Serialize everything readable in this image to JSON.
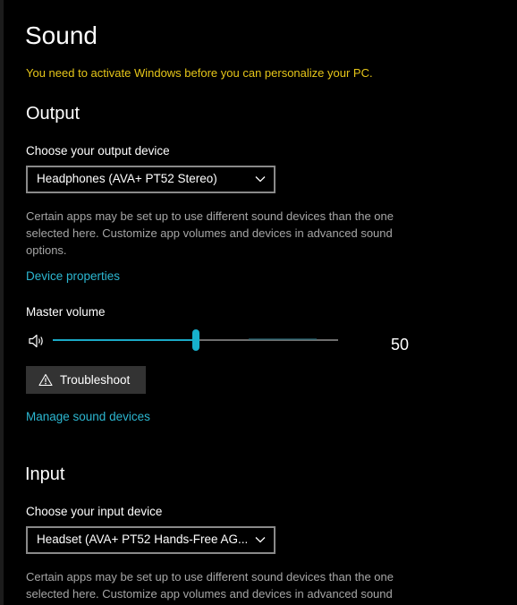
{
  "page": {
    "title": "Sound",
    "activation_notice": "You need to activate Windows before you can personalize your PC."
  },
  "output": {
    "heading": "Output",
    "device_label": "Choose your output device",
    "device_value": "Headphones (AVA+ PT52 Stereo)",
    "description": "Certain apps may be set up to use different sound devices than the one selected here. Customize app volumes and devices in advanced sound options.",
    "device_properties_link": "Device properties",
    "master_volume_label": "Master volume",
    "volume_value": "50",
    "volume_level": 50,
    "troubleshoot_label": "Troubleshoot",
    "manage_link": "Manage sound devices"
  },
  "input": {
    "heading": "Input",
    "device_label": "Choose your input device",
    "device_value": "Headset (AVA+ PT52 Hands-Free AG...",
    "description": "Certain apps may be set up to use different sound devices than the one selected here. Customize app volumes and devices in advanced sound"
  },
  "icons": {
    "chevron": "chevron-down-icon",
    "speaker": "speaker-volume-icon",
    "warning": "warning-triangle-icon"
  },
  "colors": {
    "accent": "#1aa9c6",
    "link": "#2cb7d1",
    "warning_text": "#e6c619",
    "background": "#000000"
  }
}
